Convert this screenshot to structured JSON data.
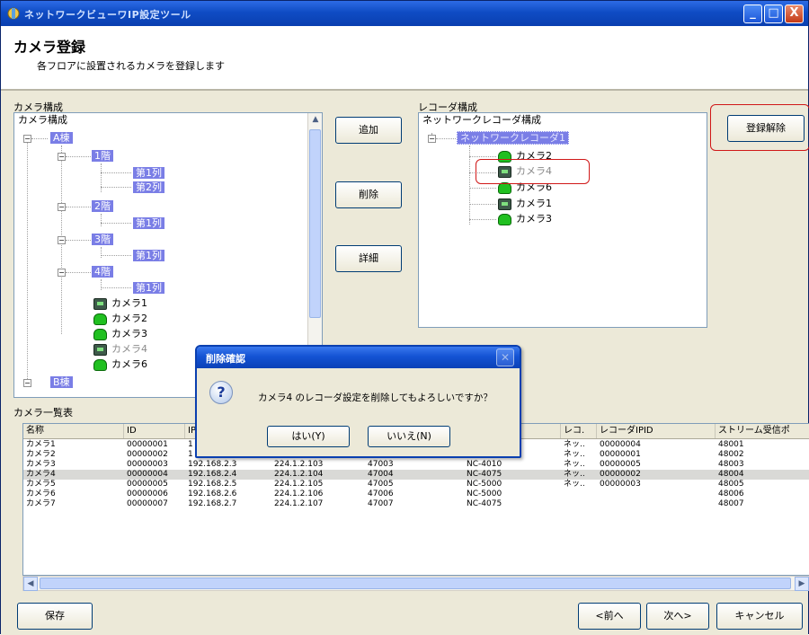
{
  "window": {
    "title": "ネットワークビューワIP設定ツール",
    "buttons": {
      "minimize": "_",
      "maximize": "□",
      "close": "X"
    }
  },
  "header": {
    "title": "カメラ登録",
    "subtitle": "各フロアに設置されるカメラを登録します"
  },
  "camera_group": {
    "label": "カメラ構成",
    "tree": {
      "root": "カメラ構成",
      "building_a": "A棟",
      "floor1": "1階",
      "floor1_row1": "第1列",
      "floor1_row2": "第2列",
      "floor2": "2階",
      "floor2_row1": "第1列",
      "floor3": "3階",
      "floor3_row1": "第1列",
      "floor4": "4階",
      "floor4_row1": "第1列",
      "cam1": "カメラ1",
      "cam2": "カメラ2",
      "cam3": "カメラ3",
      "cam4": "カメラ4",
      "cam6": "カメラ6",
      "building_b": "B棟"
    }
  },
  "middle_buttons": {
    "add": "追加",
    "delete": "削除",
    "detail": "詳細"
  },
  "recorder_group": {
    "label": "レコーダ構成",
    "tree": {
      "root": "ネットワークレコーダ構成",
      "recorder1": "ネットワークレコーダ1",
      "cam2": "カメラ2",
      "cam4": "カメラ4",
      "cam6": "カメラ6",
      "cam1": "カメラ1",
      "cam3": "カメラ3"
    },
    "unregister_button": "登録解除"
  },
  "camera_list": {
    "label": "カメラ一覧表",
    "columns": [
      "名称",
      "ID",
      "IP",
      "",
      "",
      "",
      "レコ.",
      "レコーダIPID",
      "ストリーム受信ポ"
    ],
    "rows": [
      {
        "name": "カメラ1",
        "id": "00000001",
        "ip": "1",
        "mcast": "",
        "port": "",
        "model": "",
        "rec": "ネッ..",
        "recid": "00000004",
        "stream": "48001"
      },
      {
        "name": "カメラ2",
        "id": "00000002",
        "ip": "1",
        "mcast": "",
        "port": "",
        "model": "",
        "rec": "ネッ..",
        "recid": "00000001",
        "stream": "48002"
      },
      {
        "name": "カメラ3",
        "id": "00000003",
        "ip": "192.168.2.3",
        "mcast": "224.1.2.103",
        "port": "47003",
        "model": "NC-4010",
        "rec": "ネッ..",
        "recid": "00000005",
        "stream": "48003"
      },
      {
        "name": "カメラ4",
        "id": "00000004",
        "ip": "192.168.2.4",
        "mcast": "224.1.2.104",
        "port": "47004",
        "model": "NC-4075",
        "rec": "ネッ..",
        "recid": "00000002",
        "stream": "48004"
      },
      {
        "name": "カメラ5",
        "id": "00000005",
        "ip": "192.168.2.5",
        "mcast": "224.1.2.105",
        "port": "47005",
        "model": "NC-5000",
        "rec": "ネッ..",
        "recid": "00000003",
        "stream": "48005"
      },
      {
        "name": "カメラ6",
        "id": "00000006",
        "ip": "192.168.2.6",
        "mcast": "224.1.2.106",
        "port": "47006",
        "model": "NC-5000",
        "rec": "",
        "recid": "",
        "stream": "48006"
      },
      {
        "name": "カメラ7",
        "id": "00000007",
        "ip": "192.168.2.7",
        "mcast": "224.1.2.107",
        "port": "47007",
        "model": "NC-4075",
        "rec": "",
        "recid": "",
        "stream": "48007"
      }
    ]
  },
  "bottom_buttons": {
    "save": "保存",
    "back": "<前へ",
    "next": "次へ>",
    "cancel": "キャンセル"
  },
  "dialog": {
    "title": "削除確認",
    "message": "カメラ4 のレコーダ設定を削除してもよろしいですか？",
    "yes": "はい(Y)",
    "no": "いいえ(N)",
    "icon": "?"
  },
  "colors": {
    "highlight": "#d01818",
    "tree_selection": "#7a7ee6",
    "titlebar": "#0f4cc4"
  }
}
